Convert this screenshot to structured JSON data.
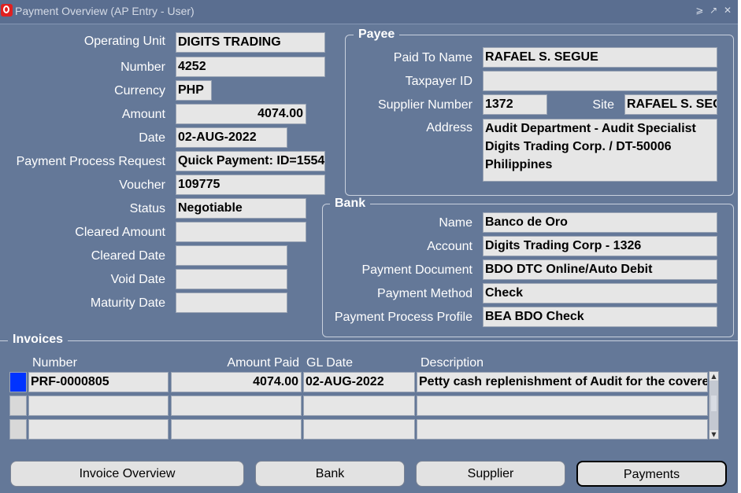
{
  "window": {
    "title": "Payment Overview (AP Entry - User)",
    "controls": "⩾ ↗ ✕"
  },
  "left": {
    "operating_unit": {
      "label": "Operating Unit",
      "value": "DIGITS TRADING"
    },
    "number": {
      "label": "Number",
      "value": "4252"
    },
    "currency": {
      "label": "Currency",
      "value": "PHP"
    },
    "amount": {
      "label": "Amount",
      "value": "4074.00"
    },
    "date": {
      "label": "Date",
      "value": "02-AUG-2022"
    },
    "ppr": {
      "label": "Payment Process Request",
      "value": "Quick Payment: ID=1554"
    },
    "voucher": {
      "label": "Voucher",
      "value": "109775"
    },
    "status": {
      "label": "Status",
      "value": "Negotiable"
    },
    "cleared_amount": {
      "label": "Cleared Amount",
      "value": ""
    },
    "cleared_date": {
      "label": "Cleared Date",
      "value": ""
    },
    "void_date": {
      "label": "Void Date",
      "value": ""
    },
    "maturity_date": {
      "label": "Maturity Date",
      "value": ""
    }
  },
  "payee": {
    "title": "Payee",
    "paid_to_name": {
      "label": "Paid To Name",
      "value": "RAFAEL S. SEGUE"
    },
    "taxpayer_id": {
      "label": "Taxpayer ID",
      "value": ""
    },
    "supplier_number": {
      "label": "Supplier Number",
      "value": "1372"
    },
    "site": {
      "label": "Site",
      "value": "RAFAEL S. SEGUE"
    },
    "address": {
      "label": "Address",
      "value": "Audit Department - Audit Specialist Digits Trading Corp. / DT-50006 Philippines"
    }
  },
  "bank": {
    "title": "Bank",
    "name": {
      "label": "Name",
      "value": "Banco de Oro"
    },
    "account": {
      "label": "Account",
      "value": "Digits Trading Corp - 1326"
    },
    "payment_document": {
      "label": "Payment Document",
      "value": "BDO DTC Online/Auto Debit"
    },
    "payment_method": {
      "label": "Payment Method",
      "value": "Check"
    },
    "payment_process_profile": {
      "label": "Payment Process Profile",
      "value": "BEA BDO Check"
    }
  },
  "invoices": {
    "title": "Invoices",
    "columns": {
      "number": "Number",
      "amount_paid": "Amount Paid",
      "gl_date": "GL Date",
      "description": "Description"
    },
    "rows": [
      {
        "number": "PRF-0000805",
        "amount_paid": "4074.00",
        "gl_date": "02-AUG-2022",
        "description": "Petty cash replenishment of Audit for the covered"
      },
      {
        "number": "",
        "amount_paid": "",
        "gl_date": "",
        "description": ""
      },
      {
        "number": "",
        "amount_paid": "",
        "gl_date": "",
        "description": ""
      }
    ]
  },
  "buttons": {
    "invoice_overview": "Invoice Overview",
    "bank": "Bank",
    "supplier": "Supplier",
    "payments": "Payments"
  }
}
